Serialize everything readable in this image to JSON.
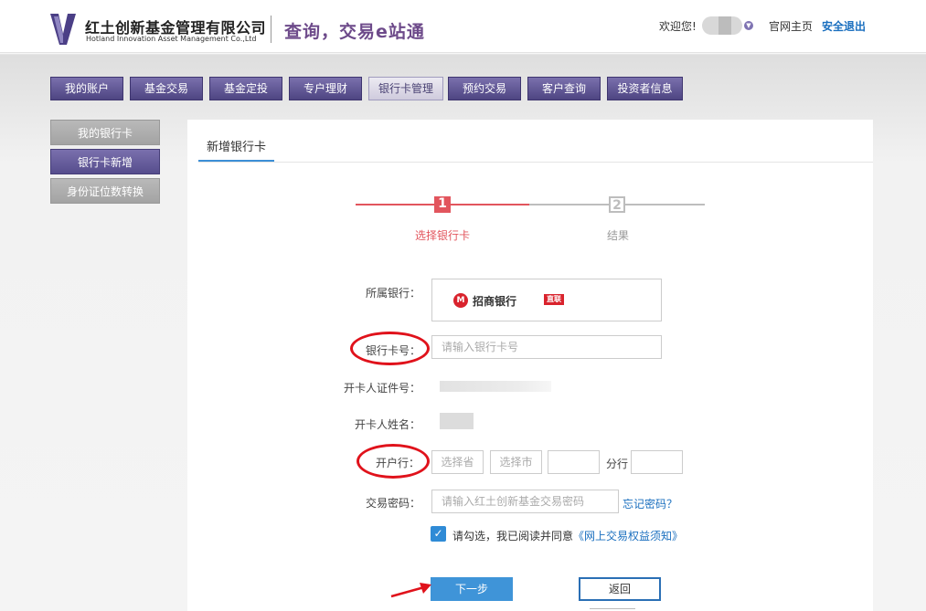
{
  "header": {
    "company_cn": "红土创新基金管理有限公司",
    "company_en": "Hotland Innovation Asset Management Co.,Ltd",
    "slogan": "查询，交易e站通",
    "welcome": "欢迎您!",
    "home_link": "官网主页",
    "logout_link": "安全退出"
  },
  "nav": {
    "items": [
      "我的账户",
      "基金交易",
      "基金定投",
      "专户理财",
      "银行卡管理",
      "预约交易",
      "客户查询",
      "投资者信息"
    ],
    "active_index": 4
  },
  "sidebar": {
    "items": [
      "我的银行卡",
      "银行卡新增",
      "身份证位数转换"
    ],
    "active_index": 1
  },
  "main": {
    "tab": "新增银行卡",
    "steps": [
      {
        "num": "1",
        "label": "选择银行卡"
      },
      {
        "num": "2",
        "label": "结果"
      }
    ],
    "form": {
      "bank_label": "所属银行：",
      "bank_name": "招商银行",
      "bank_badge": "直联",
      "card_label": "银行卡号：",
      "card_placeholder": "请输入银行卡号",
      "id_label": "开卡人证件号：",
      "name_label": "开卡人姓名：",
      "branch_label": "开户行：",
      "province_placeholder": "选择省",
      "city_placeholder": "选择市",
      "branch_suffix": "分行",
      "pwd_label": "交易密码：",
      "pwd_placeholder": "请输入红土创新基金交易密码",
      "forgot": "忘记密码？",
      "agree_text": "请勾选，我已阅读并同意",
      "agree_link": "《网上交易权益须知》",
      "agree_checked": true,
      "next": "下一步",
      "back": "返回"
    }
  },
  "colors": {
    "accent": "#e2555d",
    "nav_purple": "#5a5190",
    "link_blue": "#1a6fbf",
    "button_blue": "#3f94d8",
    "annotation_red": "#e0121b"
  }
}
